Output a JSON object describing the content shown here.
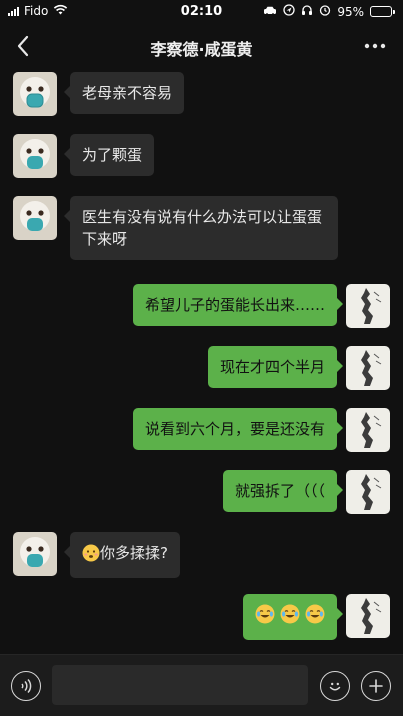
{
  "status_bar": {
    "carrier": "Fido",
    "time": "02:10",
    "battery_text": "95%",
    "battery_level": 0.95,
    "icons": [
      "signal-icon",
      "wifi-icon",
      "car-icon",
      "location-icon",
      "headphones-icon",
      "alarm-icon",
      "battery-charging-icon"
    ]
  },
  "nav": {
    "title": "李察德·咸蛋黄",
    "back_icon": "chevron-left-icon",
    "more_icon": "more-dots-icon"
  },
  "messages": [
    {
      "side": "in",
      "text": "老母亲不容易"
    },
    {
      "side": "in",
      "text": "为了颗蛋"
    },
    {
      "side": "in",
      "text": "医生有没有说有什么办法可以让蛋蛋下来呀"
    },
    {
      "side": "out",
      "text": "希望儿子的蛋能长出来……"
    },
    {
      "side": "out",
      "text": "现在才四个半月"
    },
    {
      "side": "out",
      "text": "说看到六个月，要是还没有"
    },
    {
      "side": "out",
      "text": "就强拆了（（（"
    },
    {
      "side": "in",
      "text": "你多揉揉?",
      "emoji": "worried-face-emoji"
    },
    {
      "side": "out",
      "text": "",
      "emoji": "laughing-crying-emoji x3"
    }
  ],
  "input_bar": {
    "placeholder": "",
    "voice_icon": "voice-icon",
    "emoji_icon": "smile-icon",
    "plus_icon": "plus-icon"
  },
  "colors": {
    "background": "#111111",
    "incoming_bubble": "#2c2c2c",
    "outgoing_bubble": "#5cb14a",
    "battery_fill": "#31d158"
  }
}
